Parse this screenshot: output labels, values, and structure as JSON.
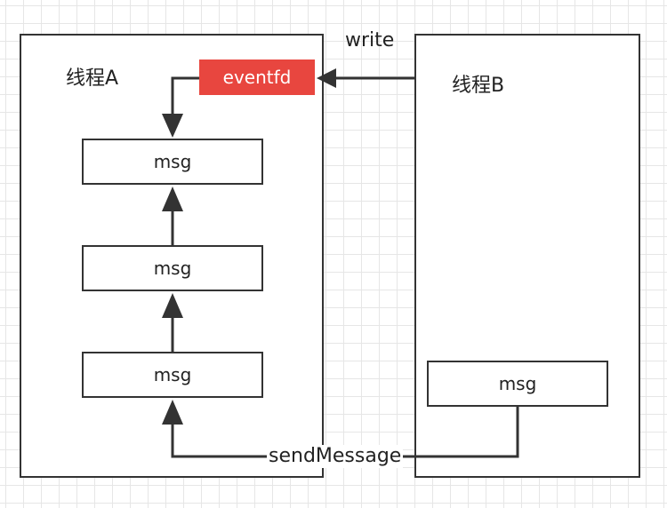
{
  "thread_a": {
    "label": "线程A"
  },
  "thread_b": {
    "label": "线程B"
  },
  "eventfd": {
    "label": "eventfd",
    "color": "#e8463f"
  },
  "queue_a": [
    {
      "label": "msg"
    },
    {
      "label": "msg"
    },
    {
      "label": "msg"
    }
  ],
  "msg_b": {
    "label": "msg"
  },
  "edges": {
    "write": "write",
    "send": "sendMessage"
  }
}
